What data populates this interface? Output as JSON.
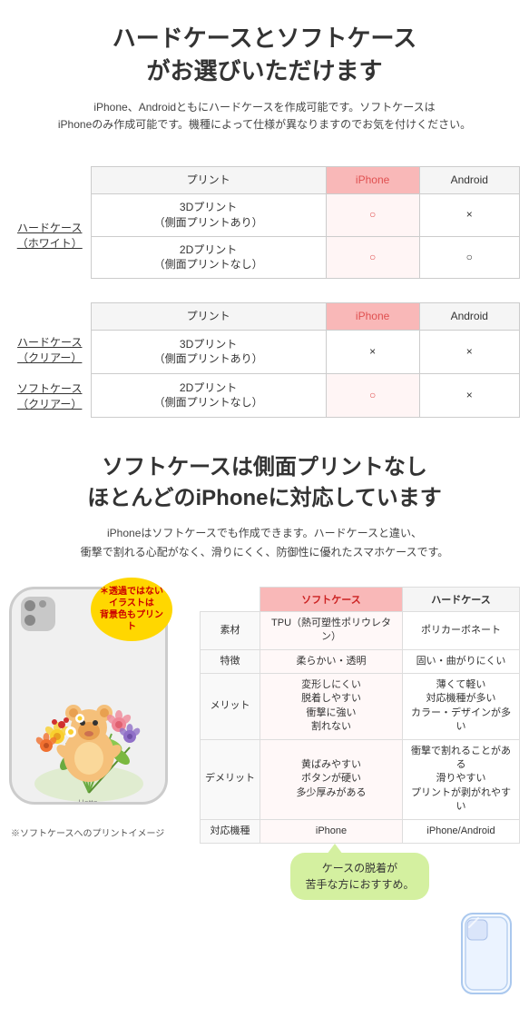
{
  "top": {
    "main_title": "ハードケースとソフトケース\nがお選びいただけます",
    "subtitle": "iPhone、Androidともにハードケースを作成可能です。ソフトケースは\niPhoneのみ作成可能です。機種によって仕様が異なりますのでお気を付けください。"
  },
  "table1": {
    "label": "ハードケース\n（ホワイト）",
    "col_print": "プリント",
    "col_iphone": "iPhone",
    "col_android": "Android",
    "rows": [
      {
        "print": "3Dプリント\n（側面プリントあり）",
        "iphone": "○",
        "android": "×"
      },
      {
        "print": "2Dプリント\n（側面プリントなし）",
        "iphone": "○",
        "android": "○"
      }
    ]
  },
  "table2": {
    "label1": "ハードケース\n（クリアー）",
    "label2": "ソフトケース\n（クリアー）",
    "col_print": "プリント",
    "col_iphone": "iPhone",
    "col_android": "Android",
    "rows": [
      {
        "print": "3Dプリント\n（側面プリントあり）",
        "iphone": "×",
        "android": "×"
      },
      {
        "print": "2Dプリント\n（側面プリントなし）",
        "iphone": "○",
        "android": "×"
      }
    ]
  },
  "middle": {
    "title": "ソフトケースは側面プリントなし\nほとんどのiPhoneに対応しています",
    "subtitle": "iPhoneはソフトケースでも作成できます。ハードケースと違い、\n衝撃で割れる心配がなく、滑りにくく、防御性に優れたスマホケースです。"
  },
  "annotation": {
    "bubble": "＊透過ではないイラストは\n背景色もプリント",
    "brand": "Hotto\nMotto"
  },
  "compare_table": {
    "col_soft": "ソフトケース",
    "col_hard": "ハードケース",
    "rows": [
      {
        "key": "素材",
        "soft": "TPU（熱可塑性ポリウレタン）",
        "hard": "ポリカーボネート"
      },
      {
        "key": "特徴",
        "soft": "柔らかい・透明",
        "hard": "固い・曲がりにくい"
      },
      {
        "key": "メリット",
        "soft": "変形しにくい\n脱着しやすい\n衝撃に強い\n割れない",
        "hard": "薄くて軽い\n対応機種が多い\nカラー・デザインが多い"
      },
      {
        "key": "デメリット",
        "soft": "黄ばみやすい\nボタンが硬い\n多少厚みがある",
        "hard": "衝撃で割れることがある\n滑りやすい\nプリントが剥がれやすい"
      },
      {
        "key": "対応機種",
        "soft": "iPhone",
        "hard": "iPhone/Android"
      }
    ]
  },
  "callout": {
    "text": "ケースの脱着が\n苦手な方におすすめ。"
  },
  "footer_note": "※ソフトケースへのプリントイメージ"
}
